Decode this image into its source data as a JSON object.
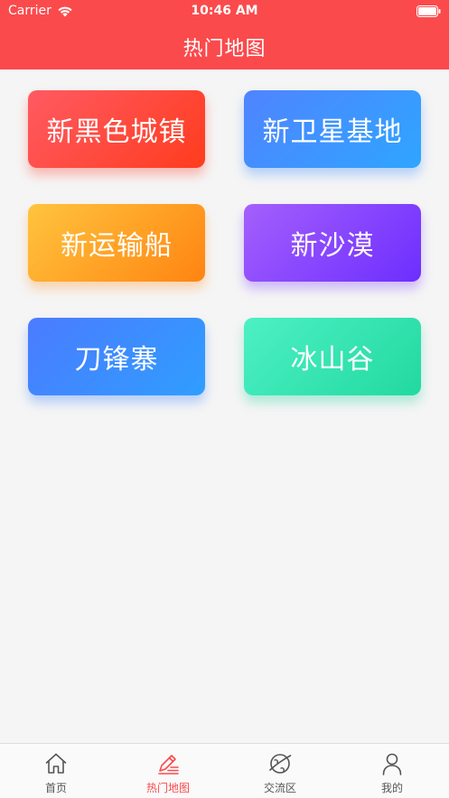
{
  "status_bar": {
    "carrier": "Carrier",
    "time": "10:46 AM"
  },
  "nav": {
    "title": "热门地图"
  },
  "maps": [
    {
      "label": "新黑色城镇"
    },
    {
      "label": "新卫星基地"
    },
    {
      "label": "新运输船"
    },
    {
      "label": "新沙漠"
    },
    {
      "label": "刀锋寨"
    },
    {
      "label": "冰山谷"
    }
  ],
  "tabs": [
    {
      "label": "首页",
      "icon": "home-icon",
      "active": false
    },
    {
      "label": "热门地图",
      "icon": "edit-icon",
      "active": true
    },
    {
      "label": "交流区",
      "icon": "planet-icon",
      "active": false
    },
    {
      "label": "我的",
      "icon": "user-icon",
      "active": false
    }
  ],
  "colors": {
    "header": "#fb4a4c",
    "tab_active": "#fb4a4c",
    "tab_inactive": "#555555"
  }
}
